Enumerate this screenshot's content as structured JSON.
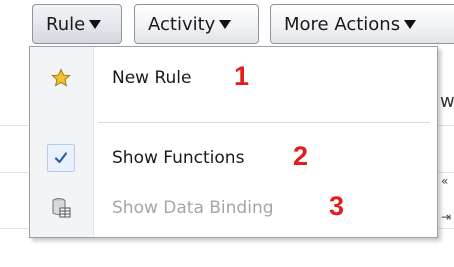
{
  "toolbar": {
    "rule_label": "Rule",
    "activity_label": "Activity",
    "more_actions_label": "More Actions"
  },
  "menu": {
    "items": [
      {
        "label": "New Rule",
        "icon": "star-icon",
        "number": "1",
        "enabled": true,
        "checked": false
      },
      {
        "label": "Show Functions",
        "icon": "checkmark-icon",
        "number": "2",
        "enabled": true,
        "checked": true
      },
      {
        "label": "Show Data Binding",
        "icon": "database-table-icon",
        "number": "3",
        "enabled": false,
        "checked": false
      }
    ]
  },
  "background": {
    "partial_text": "w"
  },
  "colors": {
    "annotation": "#e41c1c",
    "disabled_text": "#a3a6ab",
    "check": "#2a5fb0",
    "star": "#f2c12e"
  }
}
